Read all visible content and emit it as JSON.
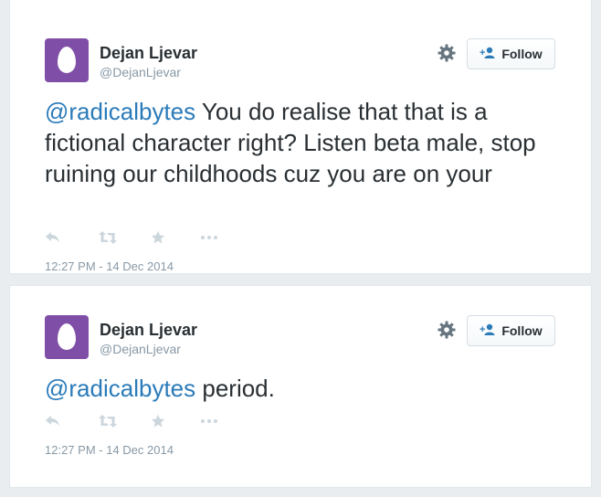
{
  "tweets": [
    {
      "author_name": "Dejan Ljevar",
      "author_handle": "@DejanLjevar",
      "follow_label": "Follow",
      "mention": "@radicalbytes",
      "text": " You do realise that that is a fictional character right? Listen beta male, stop ruining our childhoods cuz you are on your",
      "timestamp": "12:27 PM - 14 Dec 2014"
    },
    {
      "author_name": "Dejan Ljevar",
      "author_handle": "@DejanLjevar",
      "follow_label": "Follow",
      "mention": "@radicalbytes",
      "text": " period.",
      "timestamp": "12:27 PM - 14 Dec 2014"
    }
  ],
  "icons": {
    "avatar": "default-egg-avatar",
    "settings": "gear-icon",
    "follow": "add-user-icon",
    "reply": "reply-icon",
    "retweet": "retweet-icon",
    "favorite": "star-icon",
    "more": "more-icon"
  },
  "colors": {
    "avatar_bg": "#7f4fa8",
    "link": "#2b7bb9",
    "text": "#292f33",
    "muted": "#8899a6",
    "page_bg": "#e9edf0"
  }
}
